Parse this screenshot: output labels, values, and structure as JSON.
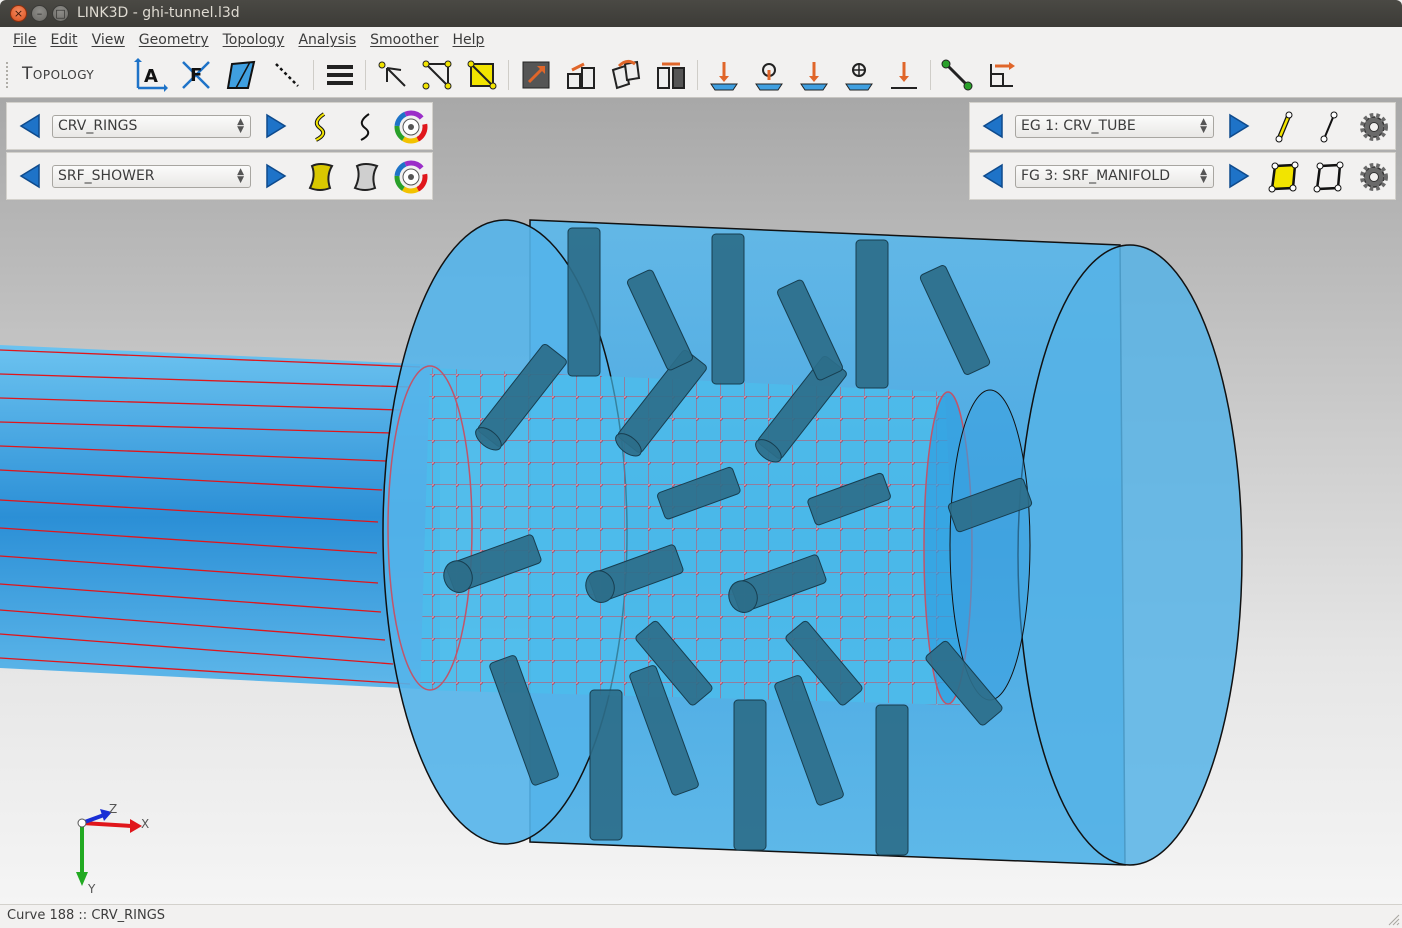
{
  "window": {
    "title": "LINK3D - ghi-tunnel.l3d",
    "close_glyph": "×",
    "minimize_glyph": "–",
    "maximize_glyph": "□"
  },
  "menu": [
    "File",
    "Edit",
    "View",
    "Geometry",
    "Topology",
    "Analysis",
    "Smoother",
    "Help"
  ],
  "toolbar": {
    "label": "Topology",
    "icons": [
      "auto-topology-icon",
      "face-topology-icon",
      "face-split-icon",
      "edge-dashed-icon",
      "list-icon",
      "select-arrow-icon",
      "select-vertices-icon",
      "select-faces-icon",
      "block-create-icon",
      "block-extrude-icon",
      "block-rotate-icon",
      "block-mirror-icon",
      "project-vertex-icon",
      "project-edge-icon",
      "project-face-icon",
      "project-block-icon",
      "project-point-icon",
      "link-edge-icon",
      "align-axes-icon"
    ]
  },
  "panels": {
    "curves": {
      "selected": "CRV_RINGS"
    },
    "surfaces": {
      "selected": "SRF_SHOWER"
    },
    "edge_groups": {
      "selected": "EG 1: CRV_TUBE"
    },
    "face_groups": {
      "selected": "FG 3: SRF_MANIFOLD"
    }
  },
  "axes": {
    "x": "X",
    "y": "Y",
    "z": "Z"
  },
  "colors": {
    "accent_blue": "#1e73c8",
    "mesh_edge": "#c0556a",
    "curve_red": "#e0161b",
    "tube_fill": "#48aee6",
    "pipe_fill": "#2a6f8c"
  },
  "status": "Curve 188 :: CRV_RINGS"
}
